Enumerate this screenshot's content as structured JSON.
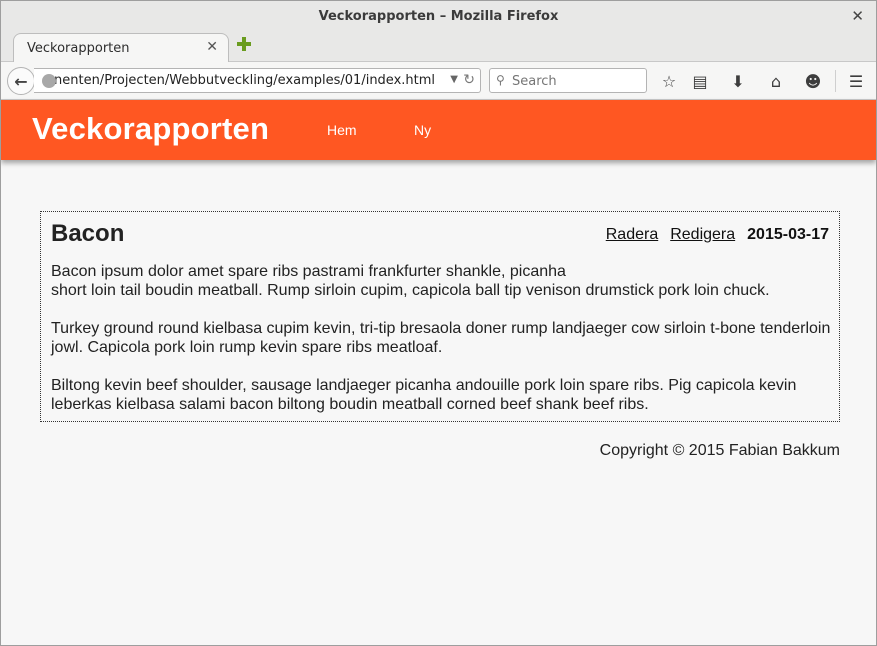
{
  "window": {
    "title": "Veckorapporten – Mozilla Firefox",
    "close_glyph": "✕"
  },
  "tab": {
    "label": "Veckorapporten",
    "close_glyph": "✕"
  },
  "navbar": {
    "url": "nenten/Projecten/Webbutveckling/examples/01/index.html",
    "search_placeholder": "Search",
    "icons": [
      "back-icon",
      "globe-icon",
      "reload-icon",
      "search-icon",
      "bookmark-star-icon",
      "reading-list-icon",
      "download-icon",
      "home-icon",
      "smiley-icon",
      "menu-icon"
    ]
  },
  "app": {
    "brand": "Veckorapporten",
    "nav": [
      "Hem",
      "Ny"
    ],
    "accent_color": "#ff5722"
  },
  "post": {
    "title": "Bacon",
    "actions": {
      "delete": "Radera",
      "edit": "Redigera"
    },
    "date": "2015-03-17",
    "paragraphs": [
      "Bacon ipsum dolor amet spare ribs pastrami frankfurter shankle, picanha",
      "short loin tail boudin meatball. Rump sirloin cupim, capicola ball tip venison drumstick pork loin chuck.",
      "Turkey ground round kielbasa cupim kevin, tri-tip bresaola doner rump landjaeger cow sirloin t-bone tenderloin jowl. Capicola pork loin rump kevin spare ribs meatloaf.",
      "Biltong kevin beef shoulder, sausage landjaeger picanha andouille pork loin spare ribs. Pig capicola kevin leberkas kielbasa salami bacon biltong boudin meatball corned beef shank beef ribs."
    ]
  },
  "footer": {
    "text": "Copyright © 2015 Fabian Bakkum"
  }
}
